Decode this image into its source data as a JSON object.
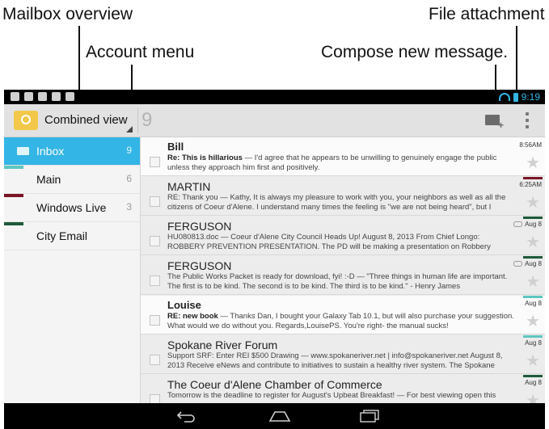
{
  "callouts": {
    "mailbox_overview": "Mailbox overview",
    "file_attachment": "File attachment",
    "account_menu": "Account menu",
    "compose_new_message": "Compose new message."
  },
  "status_bar": {
    "time": "9:19"
  },
  "action_bar": {
    "account_title": "Combined view",
    "unread_count": "9"
  },
  "sidebar": {
    "folders": [
      {
        "label": "Inbox",
        "count": "9",
        "selected": true,
        "stripe_color": ""
      },
      {
        "label": "Main",
        "count": "6",
        "selected": false,
        "stripe_color": "#5ec6c1"
      },
      {
        "label": "Windows Live",
        "count": "3",
        "selected": false,
        "stripe_color": "#7a1525"
      },
      {
        "label": "City Email",
        "count": "",
        "selected": false,
        "stripe_color": "#1e5a3a"
      }
    ]
  },
  "messages": [
    {
      "sender": "Bill",
      "subject": "Re: This is hillarious",
      "preview": " — I'd agree that he appears to be unwilling to genuinely engage the public unless they approach him first and positively.",
      "date": "8:56AM",
      "unread": true,
      "attachment": false,
      "stripe_color": ""
    },
    {
      "sender": "MARTIN",
      "subject": "",
      "preview": "RE: Thank you — Kathy, It is always my pleasure to work with you, your neighbors as well as all the citizens of Coeur d'Alene. I understand many times the feeling is \"we are not being heard\", but I",
      "date": "6:25AM",
      "unread": false,
      "attachment": false,
      "stripe_color": "#7a1525"
    },
    {
      "sender": "FERGUSON",
      "subject": "",
      "preview": "HU080813.doc — Coeur d'Alene City Council Heads Up! August 8, 2013 From Chief Longo: ROBBERY PREVENTION PRESENTATION. The PD will be making a presentation on Robbery",
      "date": "Aug 8",
      "unread": false,
      "attachment": true,
      "stripe_color": "#1e5a3a"
    },
    {
      "sender": "FERGUSON",
      "subject": "",
      "preview": "The Public Works Packet is ready for download, fyi! :-D — \"Three things in human life are important. The first is to be kind. The second is to be kind. The third is to be kind.\" - Henry James",
      "date": "Aug 8",
      "unread": false,
      "attachment": true,
      "stripe_color": "#1e5a3a"
    },
    {
      "sender": "Louise",
      "subject": "RE: new book",
      "preview": " — Thanks Dan, I bought your Galaxy Tab 10.1, but will also purchase your suggestion. What would we do without you. Regards,LouisePS. You're right- the manual sucks!",
      "date": "Aug 8",
      "unread": true,
      "attachment": false,
      "stripe_color": "#5ec6c1"
    },
    {
      "sender": "Spokane River Forum",
      "subject": "",
      "preview": "Support SRF: Enter REI $500 Drawing — www.spokaneriver.net | info@spokaneriver.net August 8, 2013 Receive eNews and contribute to initiatives to sustain a healthy river system. The Spokane",
      "date": "Aug 8",
      "unread": false,
      "attachment": false,
      "stripe_color": "#5ec6c1"
    },
    {
      "sender": "The Coeur d'Alene Chamber of Commerce",
      "subject": "",
      "preview": "Tomorrow is the deadline to register for August's Upbeat Breakfast! — For best viewing open this",
      "date": "Aug 8",
      "unread": false,
      "attachment": false,
      "stripe_color": "#1e5a3a"
    }
  ],
  "colors": {
    "accent": "#33b5e5",
    "account_icon": "#f3c84a"
  },
  "icons": {
    "compose": "compose-mail-icon",
    "overflow": "overflow-menu-icon",
    "back": "back-icon",
    "home": "home-icon",
    "recents": "recent-apps-icon"
  }
}
